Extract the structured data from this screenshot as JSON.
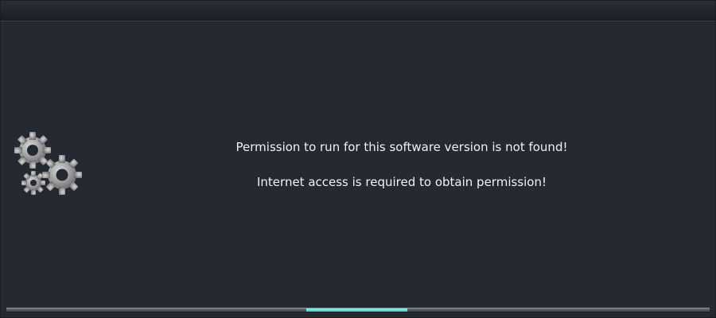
{
  "message": {
    "line1": "Permission to run for this software version is not found!",
    "line2": "Internet access is required to obtain permission!"
  },
  "icons": {
    "status": "gears-icon"
  },
  "progress": {
    "state": "indeterminate",
    "fill_color": "#4fd3cd"
  },
  "colors": {
    "background": "#252932",
    "text": "#f2f2f2",
    "accent": "#4fd3cd"
  }
}
